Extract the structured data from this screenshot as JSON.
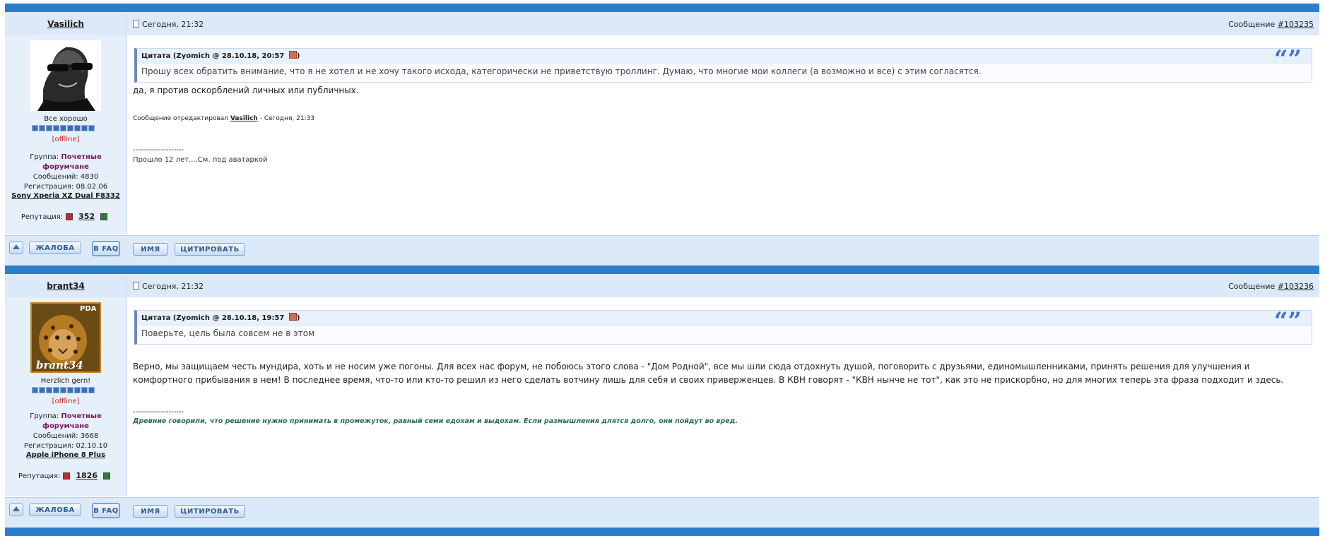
{
  "posts": [
    {
      "username": "Vasilich",
      "status_text": "Все хорошо",
      "online_status": "[offline]",
      "group_label": "Группа:",
      "group_value_1": "Почетные",
      "group_value_2": "форумчане",
      "messages": "Сообщений: 4830",
      "registration": "Регистрация: 08.02.06",
      "device": "Sony Xperia XZ Dual F8332",
      "reputation_label": "Репутация:",
      "reputation_value": "352",
      "date": "Сегодня, 21:32",
      "msg_label": "Сообщение",
      "msg_number": "#103235",
      "quote_header": "Цитата (Zyomich @ 28.10.18, 20:57",
      "quote_header_close": ")",
      "quote_text": "Прошу всех обратить внимание, что я не хотел и не хочу такого исхода, категорически не приветствую троллинг. Думаю, что многие мои коллеги (а возможно и все) с этим согласятся.",
      "body": "да, я против оскорблений личных или публичных.",
      "edited_prefix": "Сообщение отредактировал",
      "edited_by": "Vasilich",
      "edited_suffix": "- Сегодня, 21:33",
      "sig_divider": "--------------------",
      "signature": "Прошло 12 лет....См. под аватаркой"
    },
    {
      "username": "brant34",
      "status_text": "Herzlich gern!",
      "online_status": "[offline]",
      "group_label": "Группа:",
      "group_value_1": "Почетные",
      "group_value_2": "форумчане",
      "messages": "Сообщений: 3668",
      "registration": "Регистрация: 02.10.10",
      "device": "Apple iPhone 8 Plus",
      "reputation_label": "Репутация:",
      "reputation_value": "1826",
      "date": "Сегодня, 21:32",
      "msg_label": "Сообщение",
      "msg_number": "#103236",
      "quote_header": "Цитата (Zyomich @ 28.10.18, 19:57",
      "quote_header_close": ")",
      "quote_text": "Поверьте, цель была совсем не в этом",
      "body": "Верно, мы защищаем честь мундира, хоть и не носим уже погоны. Для всех нас форум, не побоюсь этого слова - \"Дом Родной\", все мы шли сюда отдохнуть душой, поговорить с друзьями, единомышленниками, принять решения для улучшения и комфортного прибывания в нем! В последнее время, что-то или кто-то решил из него сделать вотчину лишь для себя и своих приверженцев. В КВН говорят - \"КВН нынче не тот\", как это не прискорбно, но для многих теперь эта фраза подходит и здесь.",
      "sig_divider": "--------------------",
      "signature": "Древние говорили, что решение нужно принимать в промежуток, равный семи едохам и выдохам. Если размышления длятся долго, они пойдут во вред.",
      "avatar_label": "brant34",
      "avatar_badge": "PDA"
    }
  ],
  "buttons": {
    "complain": "ЖАЛОБА",
    "faq": "В FAQ",
    "name": "ИМЯ",
    "quote": "ЦИТИРОВАТЬ"
  },
  "quote_marks": "“”",
  "colors": {
    "separator": "#2a7fca",
    "header_bg": "#dce9f8",
    "group_color": "#7a1866",
    "offline_color": "#cc2222"
  }
}
